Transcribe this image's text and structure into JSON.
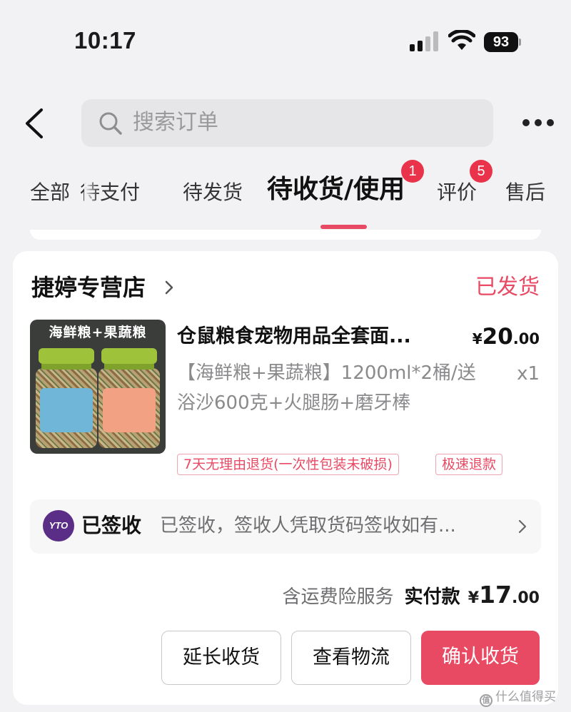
{
  "status_bar": {
    "time": "10:17",
    "battery": "93"
  },
  "header": {
    "search_placeholder": "搜索订单"
  },
  "tabs": [
    {
      "label": "全部"
    },
    {
      "label": "待支付"
    },
    {
      "label": "待发货"
    },
    {
      "label": "待收货/使用",
      "active": true,
      "badge": "1"
    },
    {
      "label": "评价",
      "badge": "5"
    },
    {
      "label": "售后"
    }
  ],
  "order": {
    "shop_name": "捷婷专营店",
    "status": "已发货",
    "product": {
      "image_banner": "海鲜粮+果蔬粮",
      "title": "仓鼠粮食宠物用品全套面...",
      "price_symbol": "¥",
      "price_int": "20",
      "price_dec": ".00",
      "spec": "【海鲜粮+果蔬粮】1200ml*2桶/送浴沙600克+火腿肠+磨牙棒",
      "quantity": "x1",
      "tags": [
        "7天无理由退货(一次性包装未破损)",
        "极速退款"
      ]
    },
    "logistics": {
      "carrier_logo_text": "YTO",
      "status": "已签收",
      "detail": "已签收，签收人凭取货码签收如有..."
    },
    "payment": {
      "insurance": "含运费险服务",
      "paid_label": "实付款",
      "symbol": "¥",
      "amount_int": "17",
      "amount_dec": ".00"
    },
    "actions": {
      "extend": "延长收货",
      "track": "查看物流",
      "confirm": "确认收货"
    }
  },
  "watermark": "什么值得买",
  "colors": {
    "accent": "#e84a64",
    "badge": "#e8334a",
    "carrier": "#5a2d86"
  }
}
